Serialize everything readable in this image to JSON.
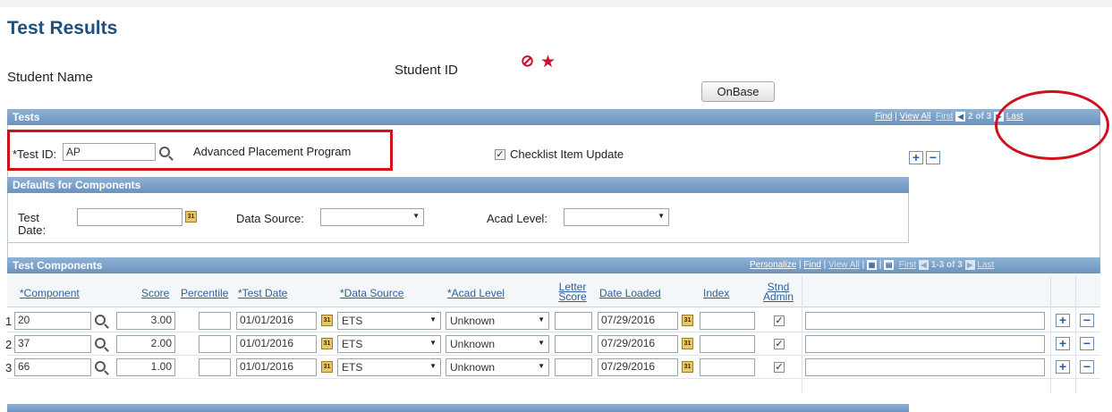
{
  "header": {
    "title": "Test Results",
    "student_name_label": "Student Name",
    "student_id_label": "Student ID",
    "onbase_label": "OnBase"
  },
  "tests": {
    "bar_title": "Tests",
    "nav": {
      "find": "Find",
      "view_all": "View All",
      "first": "First",
      "page": "2 of 3",
      "last": "Last"
    },
    "test_id_label": "*Test ID:",
    "test_id_value": "AP",
    "test_name": "Advanced Placement Program",
    "checklist_label": "Checklist Item Update",
    "checklist_checked": true
  },
  "defaults": {
    "bar_title": "Defaults for Components",
    "test_date_label": "Test Date:",
    "test_date_value": "",
    "data_source_label": "Data Source:",
    "data_source_value": "",
    "acad_level_label": "Acad Level:",
    "acad_level_value": ""
  },
  "components": {
    "bar_title": "Test Components",
    "nav": {
      "personalize": "Personalize",
      "find": "Find",
      "view_all": "View All",
      "first": "First",
      "page": "1-3 of 3",
      "last": "Last"
    },
    "columns": {
      "component": "*Component",
      "score": "Score",
      "percentile": "Percentile",
      "test_date": "*Test Date",
      "data_source": "*Data Source",
      "acad_level": "*Acad Level",
      "letter_score_1": "Letter",
      "letter_score_2": "Score",
      "date_loaded": "Date Loaded",
      "index": "Index",
      "stnd_admin_1": "Stnd",
      "stnd_admin_2": "Admin"
    },
    "rows": [
      {
        "num": "1",
        "component": "20",
        "score": "3.00",
        "percentile": "",
        "test_date": "01/01/2016",
        "data_source": "ETS",
        "acad_level": "Unknown",
        "letter_score": "",
        "date_loaded": "07/29/2016",
        "index": "",
        "stnd_admin": true,
        "comment": ""
      },
      {
        "num": "2",
        "component": "37",
        "score": "2.00",
        "percentile": "",
        "test_date": "01/01/2016",
        "data_source": "ETS",
        "acad_level": "Unknown",
        "letter_score": "",
        "date_loaded": "07/29/2016",
        "index": "",
        "stnd_admin": true,
        "comment": ""
      },
      {
        "num": "3",
        "component": "66",
        "score": "1.00",
        "percentile": "",
        "test_date": "01/01/2016",
        "data_source": "ETS",
        "acad_level": "Unknown",
        "letter_score": "",
        "date_loaded": "07/29/2016",
        "index": "",
        "stnd_admin": true,
        "comment": ""
      }
    ]
  },
  "colors": {
    "title": "#1e4f7e",
    "bar": "#7aa0c8",
    "highlight": "#d0101b"
  }
}
